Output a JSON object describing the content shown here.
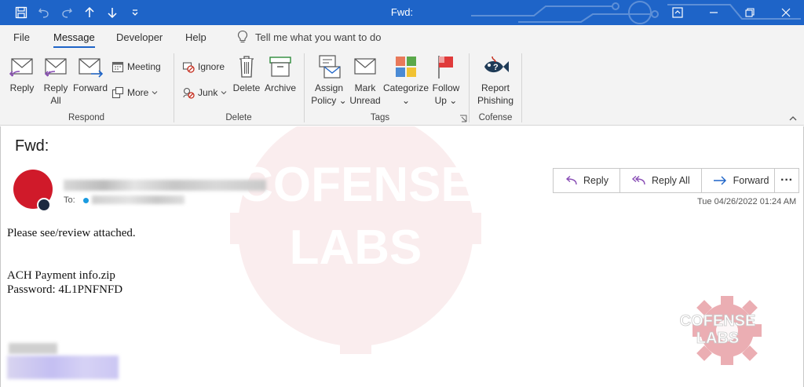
{
  "window": {
    "title": "Fwd:"
  },
  "quick_access": [
    "save-icon",
    "undo-icon",
    "redo-icon",
    "up-arrow-icon",
    "down-arrow-icon",
    "customize-icon"
  ],
  "menu_tabs": [
    {
      "label": "File"
    },
    {
      "label": "Message",
      "active": true
    },
    {
      "label": "Developer"
    },
    {
      "label": "Help"
    }
  ],
  "tell_me": "Tell me what you want to do",
  "ribbon": {
    "respond": {
      "label": "Respond",
      "reply": "Reply",
      "reply_all_1": "Reply",
      "reply_all_2": "All",
      "forward": "Forward",
      "meeting": "Meeting",
      "more": "More"
    },
    "delete": {
      "label": "Delete",
      "ignore": "Ignore",
      "junk": "Junk",
      "delete": "Delete",
      "archive": "Archive"
    },
    "tags": {
      "label": "Tags",
      "assign_1": "Assign",
      "assign_2": "Policy",
      "mark_1": "Mark",
      "mark_2": "Unread",
      "categorize": "Categorize",
      "follow_1": "Follow",
      "follow_2": "Up"
    },
    "cofense": {
      "label": "Cofense",
      "report_1": "Report",
      "report_2": "Phishing"
    }
  },
  "message": {
    "subject": "Fwd:",
    "to_label": "To:",
    "actions": {
      "reply": "Reply",
      "reply_all": "Reply All",
      "forward": "Forward"
    },
    "timestamp": "Tue 04/26/2022 01:24 AM",
    "body": {
      "line1": "Please see/review attached.",
      "line2": "ACH Payment info.zip",
      "line3": "Password: 4L1PNFNFD"
    },
    "watermark_1": "COFENSE",
    "watermark_2": "LABS",
    "badge_1": "COFENSE",
    "badge_2": "LABS"
  },
  "colors": {
    "titlebar": "#1e64c8",
    "ribbon_bg": "#f3f3f3",
    "avatar": "#d01a2a",
    "accent": "#1e64c8"
  }
}
